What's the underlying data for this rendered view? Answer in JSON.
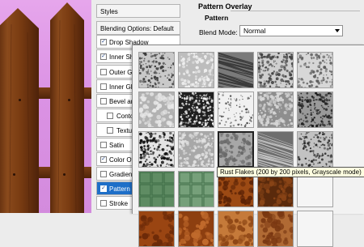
{
  "styles_panel": {
    "header_styles": "Styles",
    "header_blending": "Blending Options: Default",
    "items": [
      {
        "label": "Drop Shadow",
        "checked": true
      },
      {
        "label": "Inner Shadow",
        "checked": true
      },
      {
        "label": "Outer Glow",
        "checked": false
      },
      {
        "label": "Inner Glow",
        "checked": false
      },
      {
        "label": "Bevel and Emboss",
        "checked": false
      },
      {
        "label": "Contour",
        "checked": false
      },
      {
        "label": "Texture",
        "checked": false
      },
      {
        "label": "Satin",
        "checked": false
      },
      {
        "label": "Color Overlay",
        "checked": true
      },
      {
        "label": "Gradient Overlay",
        "checked": false
      },
      {
        "label": "Pattern Overlay",
        "checked": true
      },
      {
        "label": "Stroke",
        "checked": false
      }
    ]
  },
  "pattern_overlay": {
    "section_title": "Pattern Overlay",
    "group_title": "Pattern",
    "blend_mode_label": "Blend Mode:",
    "blend_mode_value": "Normal"
  },
  "pattern_picker": {
    "tooltip": "Rust Flakes (200 by 200 pixels, Grayscale mode)",
    "selected_index": 12
  }
}
